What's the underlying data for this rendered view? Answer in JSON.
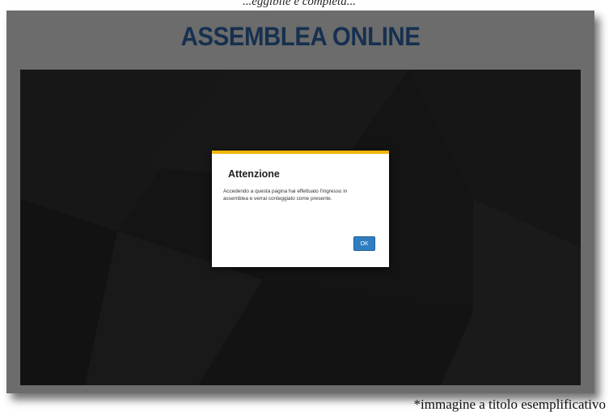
{
  "top_caption": "...eggibile e completa...",
  "app": {
    "title": "ASSEMBLEA ONLINE"
  },
  "modal": {
    "title": "Attenzione",
    "message": "Accedendo a questa pagina hai effettuato l'ingresso in assemblea e verrai conteggiato come presente.",
    "ok_label": "OK"
  },
  "caption": "*immagine a titolo esemplificativo",
  "colors": {
    "frame": "#6c6c6c",
    "title": "#16304f",
    "screen": "#141414",
    "modal_accent": "#f0b400",
    "ok_button": "#2f7ec1"
  }
}
